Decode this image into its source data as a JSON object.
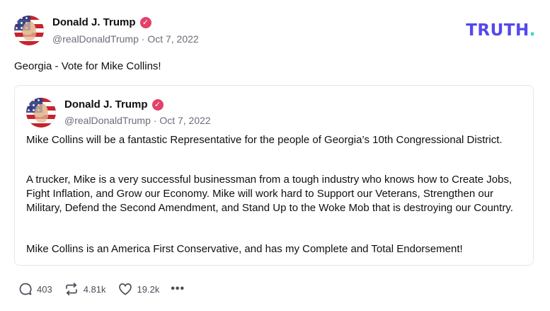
{
  "brand": {
    "logo_main": "TRUTH",
    "logo_dot": ".",
    "dot_color": "#36d4c4",
    "logo_color": "#5448ee"
  },
  "post": {
    "author": {
      "name": "Donald J. Trump",
      "verified_icon": "verified-badge-icon",
      "verified_color": "#e2416b"
    },
    "handle": "@realDonaldTrump",
    "separator": "·",
    "date": "Oct 7, 2022",
    "text": "Georgia - Vote for Mike Collins!"
  },
  "quote": {
    "author": {
      "name": "Donald J. Trump"
    },
    "handle": "@realDonaldTrump",
    "separator": "·",
    "date": "Oct 7, 2022",
    "paragraphs": [
      "Mike Collins will be a fantastic Representative for the people of Georgia’s 10th Congressional District.",
      "A trucker, Mike is a very successful businessman from a tough industry who knows how to Create Jobs, Fight Inflation, and Grow our Economy.  Mike will work hard to Support our Veterans, Strengthen our Military, Defend the Second Amendment, and Stand Up to the Woke Mob that is destroying our Country.",
      "Mike Collins is an America First Conservative, and has my Complete and Total Endorsement!"
    ]
  },
  "actions": {
    "replies": {
      "icon": "reply-icon",
      "count": "403"
    },
    "retruths": {
      "icon": "retruth-icon",
      "count": "4.81k"
    },
    "likes": {
      "icon": "heart-icon",
      "count": "19.2k"
    },
    "more": {
      "icon": "more-icon",
      "label": "•••"
    }
  }
}
